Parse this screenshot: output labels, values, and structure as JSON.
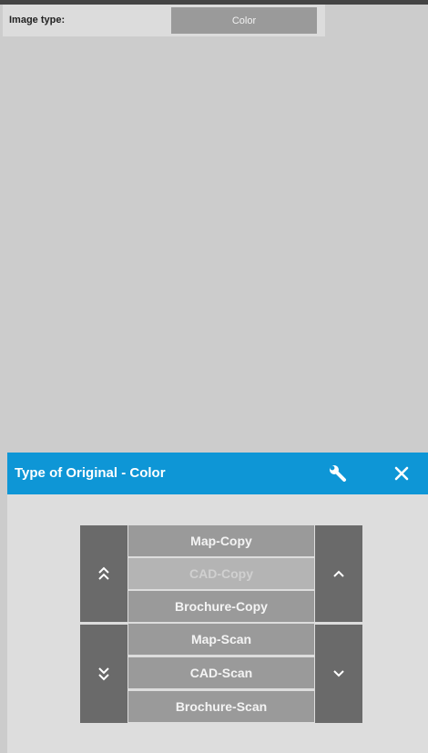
{
  "image_type": {
    "label": "Image type:",
    "value": "Color"
  },
  "dialog": {
    "title": "Type of Original - Color",
    "icons": {
      "settings": "wrench-icon",
      "close": "close-icon"
    },
    "colors": {
      "header": "#0e96d6",
      "item": "#9a9a9a",
      "scroll_button": "#6a6a6a"
    },
    "items": [
      {
        "label": "Map-Copy",
        "enabled": true
      },
      {
        "label": "CAD-Copy",
        "enabled": false
      },
      {
        "label": "Brochure-Copy",
        "enabled": true
      },
      {
        "label": "Map-Scan",
        "enabled": true
      },
      {
        "label": "CAD-Scan",
        "enabled": true
      },
      {
        "label": "Brochure-Scan",
        "enabled": true
      }
    ]
  }
}
